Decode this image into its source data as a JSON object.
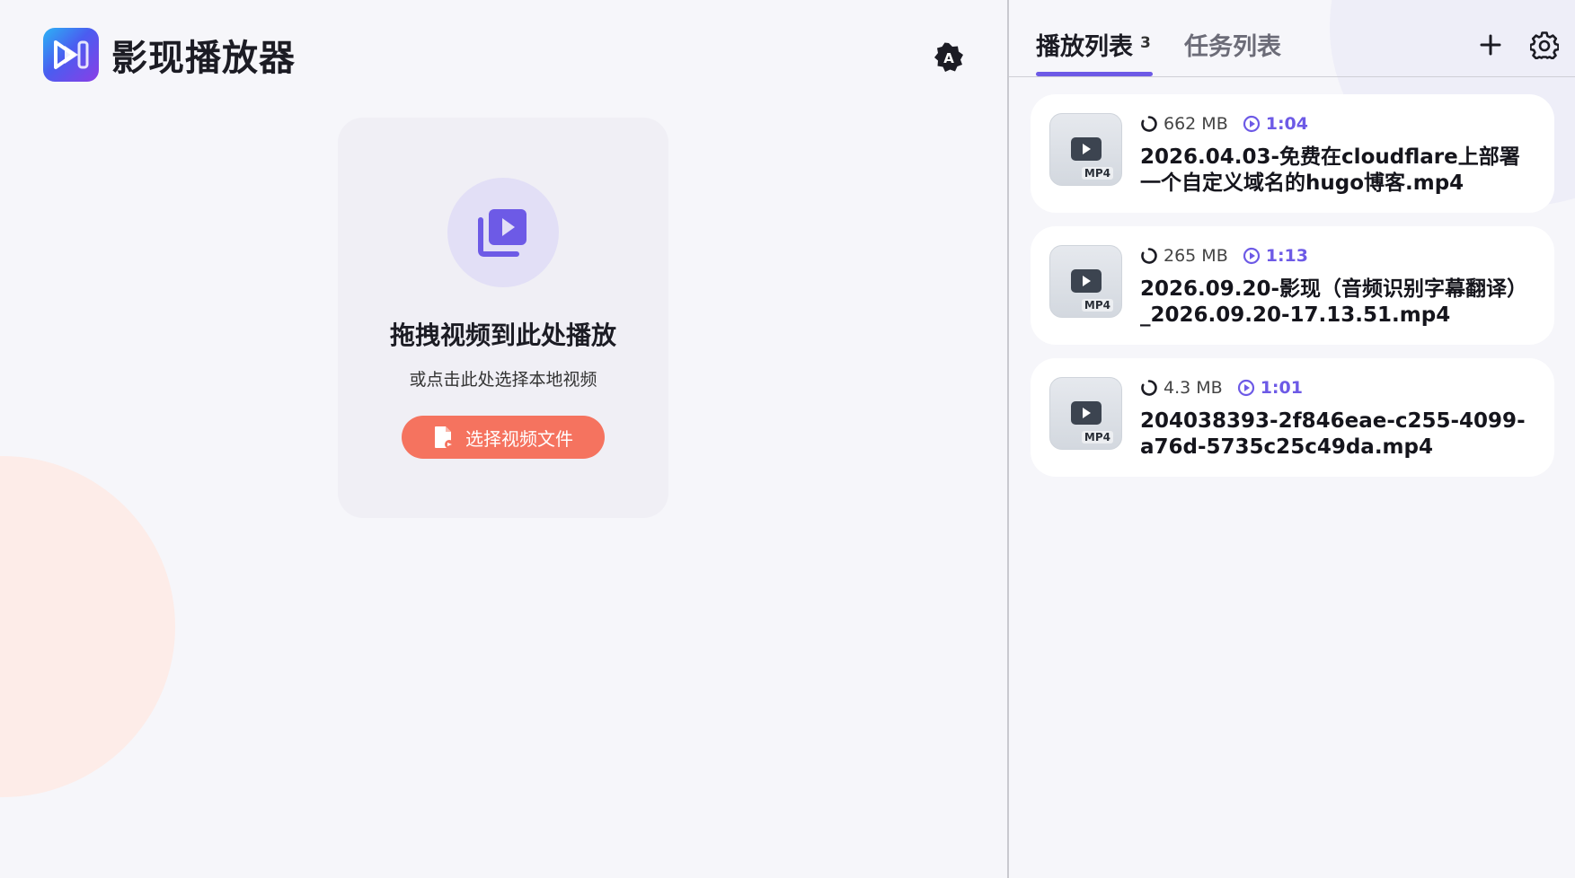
{
  "app": {
    "title": "影现播放器"
  },
  "drop_zone": {
    "title": "拖拽视频到此处播放",
    "subtitle": "或点击此处选择本地视频",
    "button_label": "选择视频文件"
  },
  "tabs": [
    {
      "label": "播放列表",
      "count": "3",
      "active": true
    },
    {
      "label": "任务列表",
      "active": false
    }
  ],
  "playlist": [
    {
      "format": "MP4",
      "size": "662 MB",
      "duration": "1:04",
      "title": "2026.04.03-免费在cloudflare上部署一个自定义域名的hugo博客.mp4"
    },
    {
      "format": "MP4",
      "size": "265 MB",
      "duration": "1:13",
      "title": "2026.09.20-影现（音频识别字幕翻译）_2026.09.20-17.13.51.mp4"
    },
    {
      "format": "MP4",
      "size": "4.3 MB",
      "duration": "1:01",
      "title": "204038393-2f846eae-c255-4099-a76d-5735c25c49da.mp4"
    }
  ],
  "colors": {
    "accent": "#6d5ae6",
    "button": "#f5735f",
    "background": "#f6f6fa",
    "card": "#ffffff"
  },
  "icons": {
    "logo": "play-logo-icon",
    "theme": "auto-theme-icon",
    "drop": "video-library-icon",
    "file": "file-icon",
    "add": "plus-icon",
    "settings": "gear-icon",
    "size": "loading-ring-icon",
    "duration": "play-circle-icon"
  }
}
